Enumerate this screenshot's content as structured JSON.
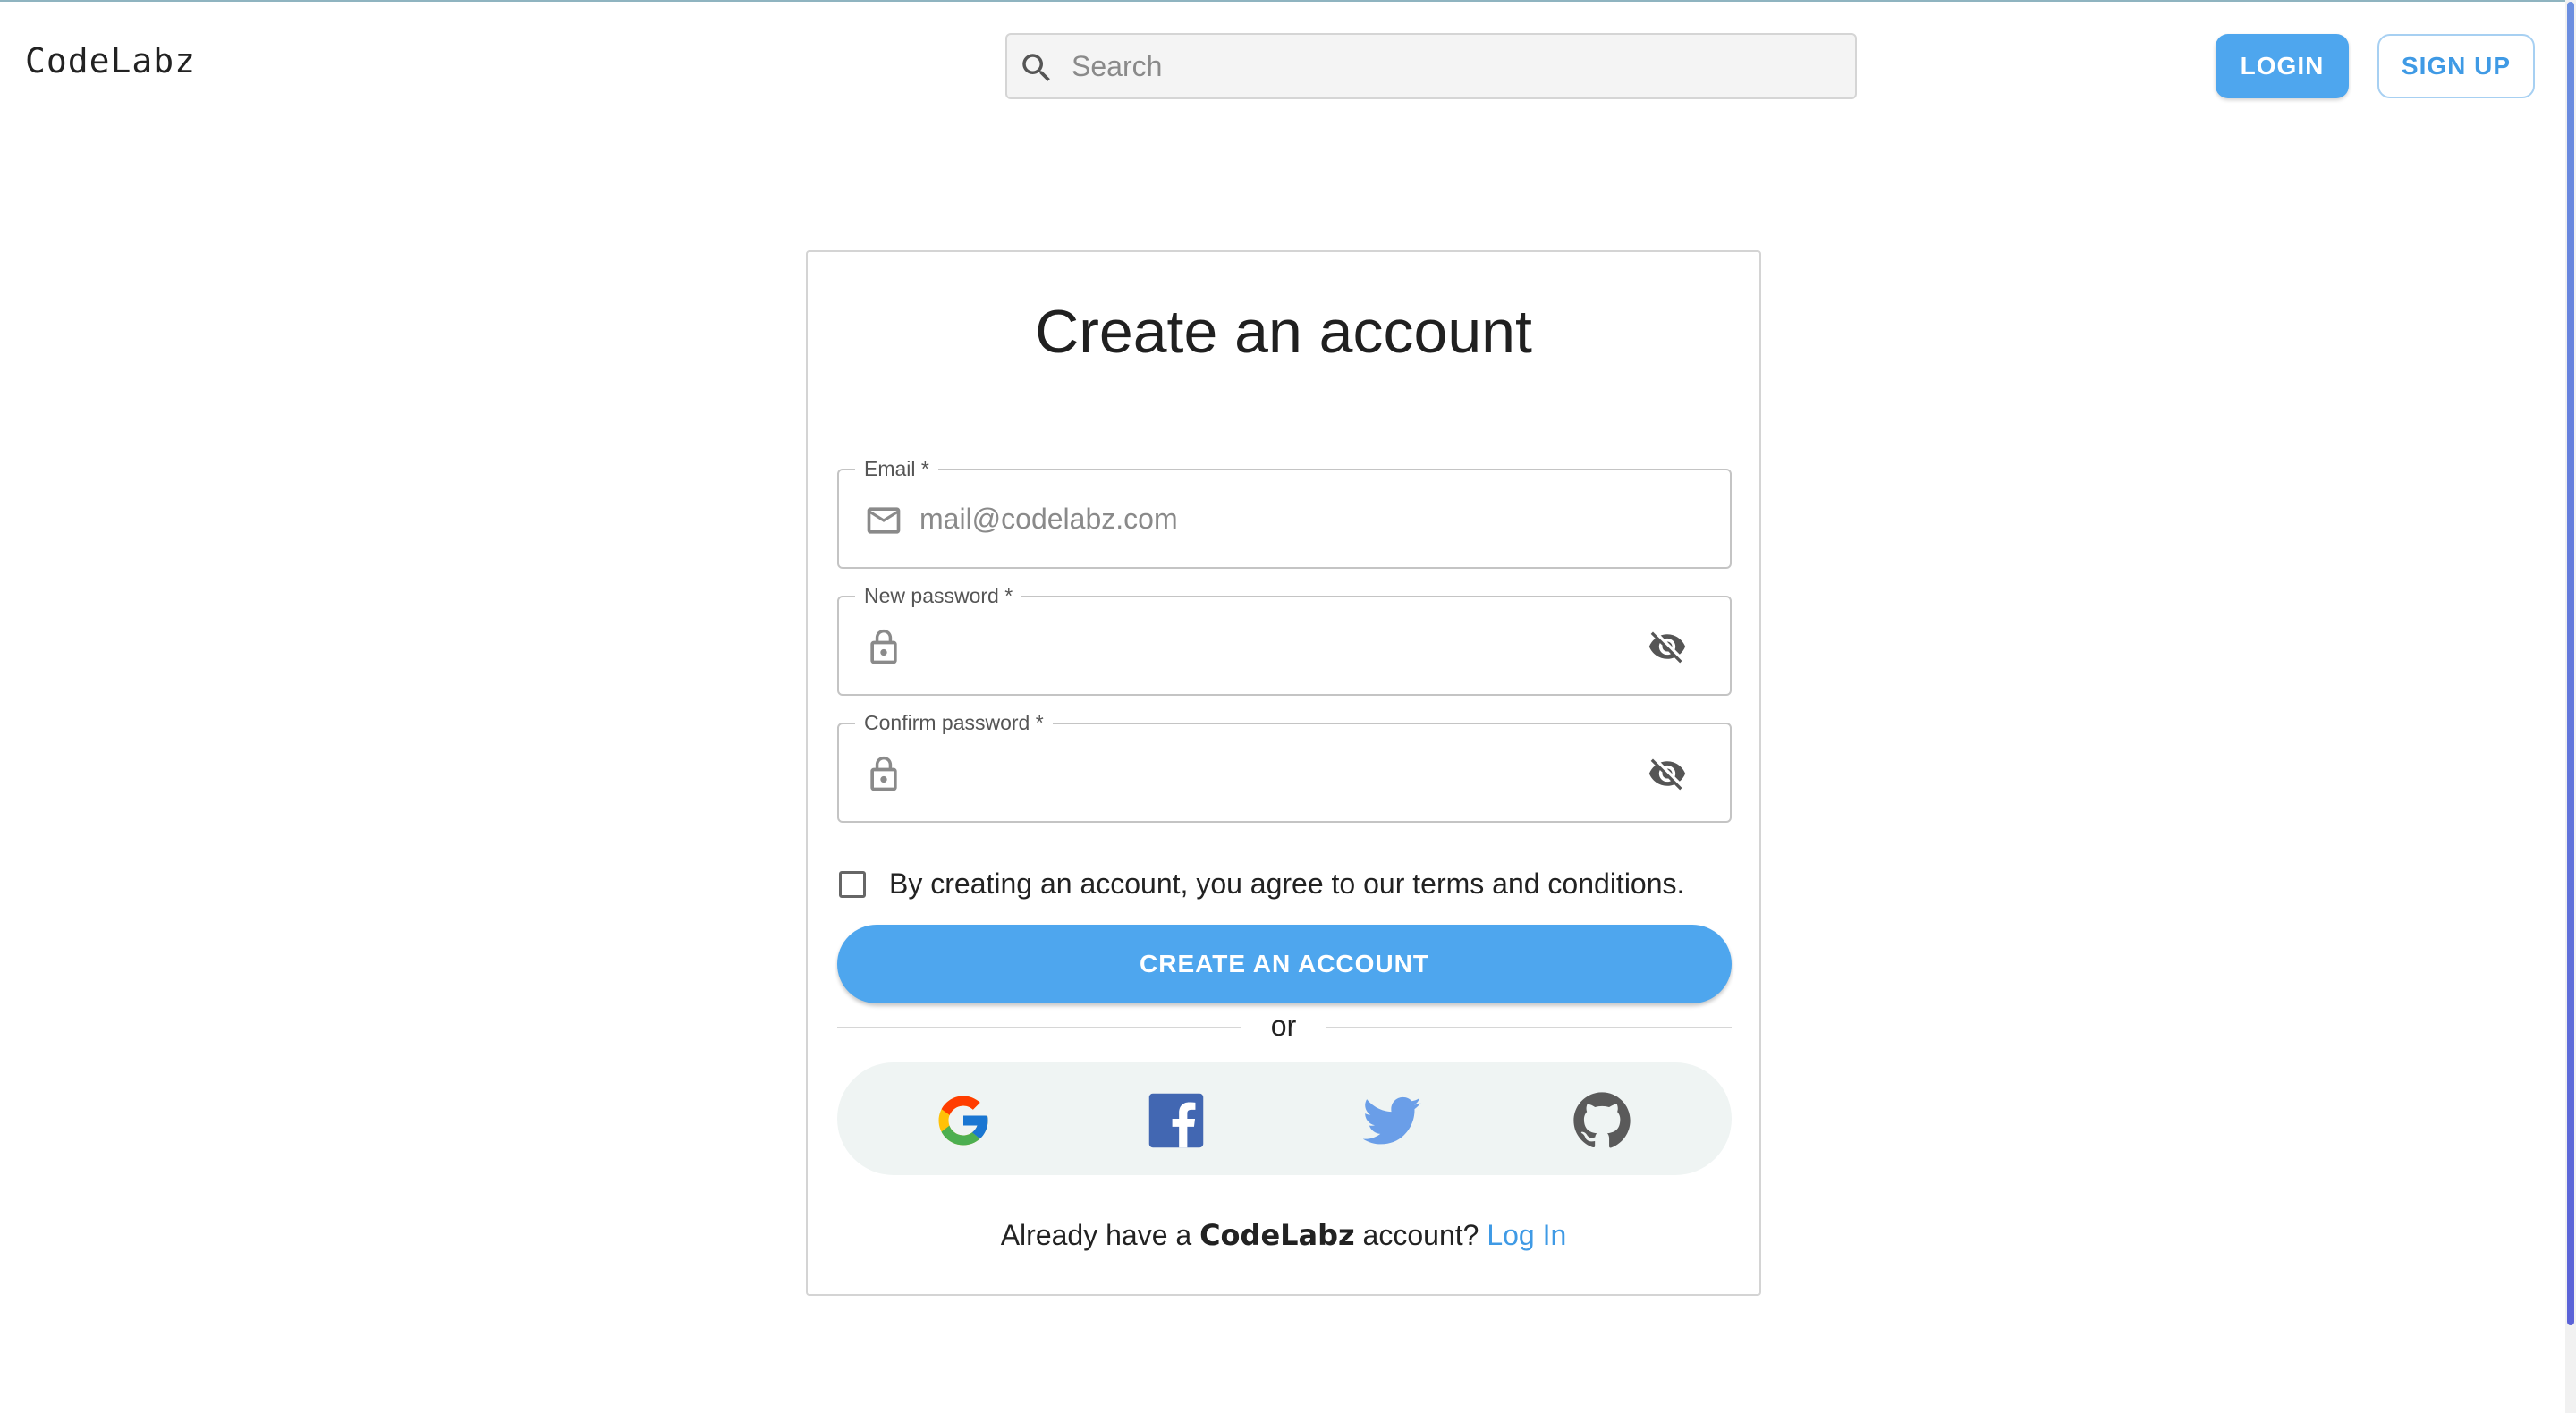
{
  "header": {
    "logo": "CodeLabz",
    "search_placeholder": "Search",
    "login_label": "LOGIN",
    "signup_label": "SIGN UP"
  },
  "signup_form": {
    "title": "Create an account",
    "email": {
      "label": "Email *",
      "placeholder": "mail@codelabz.com",
      "value": "",
      "icon": "mail-icon"
    },
    "new_password": {
      "label": "New password *",
      "value": "",
      "icon": "lock-icon",
      "toggle_icon": "eye-off-icon"
    },
    "confirm_password": {
      "label": "Confirm password *",
      "value": "",
      "icon": "lock-icon",
      "toggle_icon": "eye-off-icon"
    },
    "terms_text": "By creating an account, you agree to our terms and conditions.",
    "terms_checked": false,
    "submit_label": "CREATE AN ACCOUNT",
    "divider_text": "or",
    "social_icons": [
      "google-icon",
      "facebook-icon",
      "twitter-icon",
      "github-icon"
    ],
    "footer": {
      "prefix": "Already have a",
      "brand": "CodeLabz",
      "suffix": "account?",
      "link": "Log In"
    }
  },
  "colors": {
    "primary": "#4ea6ee",
    "link": "#3f9ae5",
    "social_background": "#eff4f3"
  }
}
